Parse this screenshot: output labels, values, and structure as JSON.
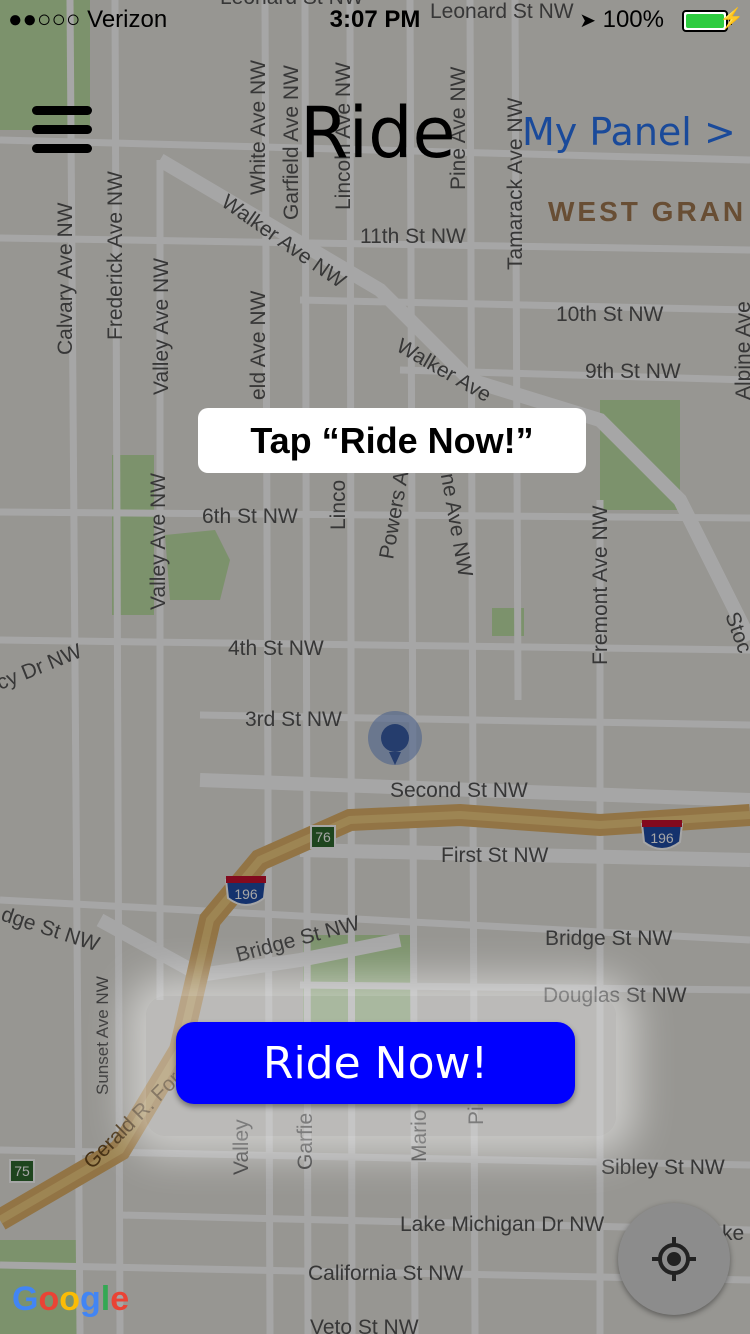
{
  "status_bar": {
    "carrier": "●●○○○ Verizon",
    "time": "3:07 PM",
    "battery": "100%",
    "battery_color": "#2ecc40"
  },
  "header": {
    "title": "Ride",
    "panel_link": "My Panel >",
    "menu_icon": "hamburger-icon"
  },
  "tooltip": {
    "text": "Tap “Ride Now!”"
  },
  "action": {
    "ride_now_label": "Ride Now!",
    "color": "#0000ff"
  },
  "map": {
    "district": "WEST GRAN",
    "streets": {
      "leonard_top": "Leonard St NW",
      "leonard_top2": "Leonard St NW",
      "white": "White Ave NW",
      "garfield": "Garfield Ave NW",
      "lincoln": "Lincoln Ave NW",
      "pine": "Pine Ave NW",
      "tamarack": "Tamarack Ave NW",
      "walker": "Walker Ave NW",
      "walker2": "Walker Ave",
      "eleventh": "11th St NW",
      "tenth": "10th St NW",
      "ninth": "9th St NW",
      "calvary": "Calvary Ave NW",
      "frederick": "Frederick Ave NW",
      "valley_upper": "Valley Ave NW",
      "field": "eld Ave NW",
      "alpine": "Alpine Ave",
      "sixth": "6th St NW",
      "valley_mid": "Valley Ave NW",
      "lincoln_mid": "Linco",
      "powers": "Powers A",
      "pine_mid": "ine Ave NW",
      "fremont": "Fremont Ave NW",
      "stocking": "Stoc",
      "cy_dr": "cy Dr NW",
      "fourth": "4th St NW",
      "third": "3rd St NW",
      "second": "Second St NW",
      "first": "First St NW",
      "dge": "dge St NW",
      "bridge1": "Bridge St NW",
      "bridge2": "Bridge St NW",
      "douglas": "Douglas St NW",
      "sunset": "Sunset Ave NW",
      "gerald": "Gerald R. Ford Fwy",
      "valley_low": "Valley",
      "garfield_low": "Garfie",
      "marion": "Mario",
      "pine_low": "Pi",
      "sibley": "Sibley St NW",
      "lake_michigan": "Lake Michigan Dr NW",
      "california": "California St NW",
      "veto": "Veto St NW",
      "ke": "ke"
    },
    "shields": {
      "i196_a": "196",
      "i196_b": "196",
      "r76": "76",
      "r75": "75"
    },
    "pin_color": "#3a5fa8",
    "locate_icon": "crosshair-icon",
    "google": [
      "G",
      "o",
      "o",
      "g",
      "l",
      "e"
    ]
  }
}
